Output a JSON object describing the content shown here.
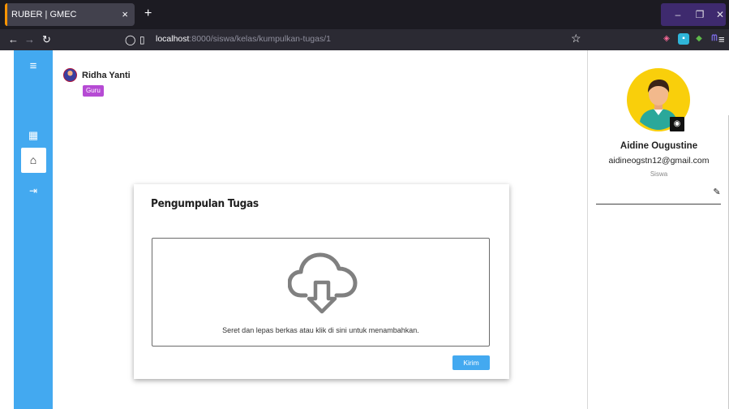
{
  "browser": {
    "tab_title": "RUBER | GMEC",
    "tab_close": "×",
    "new_tab": "+",
    "url_host": "localhost",
    "url_path": ":8000/siswa/kelas/kumpulkan-tugas/1",
    "window_buttons": [
      "–",
      "❐",
      "✕"
    ]
  },
  "sidebar": {
    "items": [
      {
        "icon": "hamburger-icon",
        "glyph": "≡"
      },
      {
        "icon": "dashboard-icon",
        "glyph": "▦"
      },
      {
        "icon": "home-icon",
        "glyph": "⌂"
      },
      {
        "icon": "logout-icon",
        "glyph": "⇥"
      }
    ]
  },
  "header": {
    "user_name": "Ridha Yanti",
    "role_badge": "Guru"
  },
  "card": {
    "title": "Pengumpulan Tugas",
    "dropzone_text": "Seret dan lepas berkas atau klik di sini untuk menambahkan.",
    "submit_label": "Kirim"
  },
  "profile": {
    "name": "Aidine Ougustine",
    "email": "aidineogstn12@gmail.com",
    "role": "Siswa"
  },
  "colors": {
    "sidebar": "#43a9f0",
    "badge": "#b64bd4",
    "button": "#43a9f0",
    "avatar_bg": "#f9cf0b"
  }
}
